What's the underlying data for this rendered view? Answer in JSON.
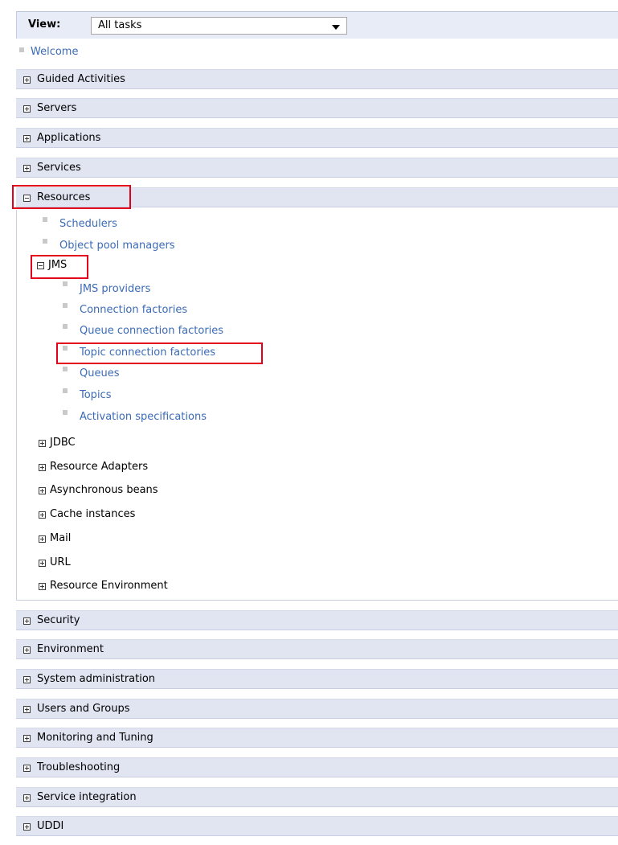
{
  "view": {
    "label": "View:",
    "selected": "All tasks"
  },
  "welcome": "Welcome",
  "sections": {
    "guided_activities": "Guided Activities",
    "servers": "Servers",
    "applications": "Applications",
    "services": "Services",
    "resources": "Resources",
    "security": "Security",
    "environment": "Environment",
    "system_administration": "System administration",
    "users_and_groups": "Users and Groups",
    "monitoring_and_tuning": "Monitoring and Tuning",
    "troubleshooting": "Troubleshooting",
    "service_integration": "Service integration",
    "uddi": "UDDI"
  },
  "resources": {
    "schedulers": "Schedulers",
    "object_pool_managers": "Object pool managers",
    "jms": {
      "label": "JMS",
      "items": [
        "JMS providers",
        "Connection factories",
        "Queue connection factories",
        "Topic connection factories",
        "Queues",
        "Topics",
        "Activation specifications"
      ]
    },
    "jdbc": "JDBC",
    "resource_adapters": "Resource Adapters",
    "asynchronous_beans": "Asynchronous beans",
    "cache_instances": "Cache instances",
    "mail": "Mail",
    "url": "URL",
    "resource_environment": "Resource Environment"
  },
  "colors": {
    "link": "#3b6bb6",
    "section_bg": "#e1e4f1",
    "highlight": "#e3001b"
  }
}
